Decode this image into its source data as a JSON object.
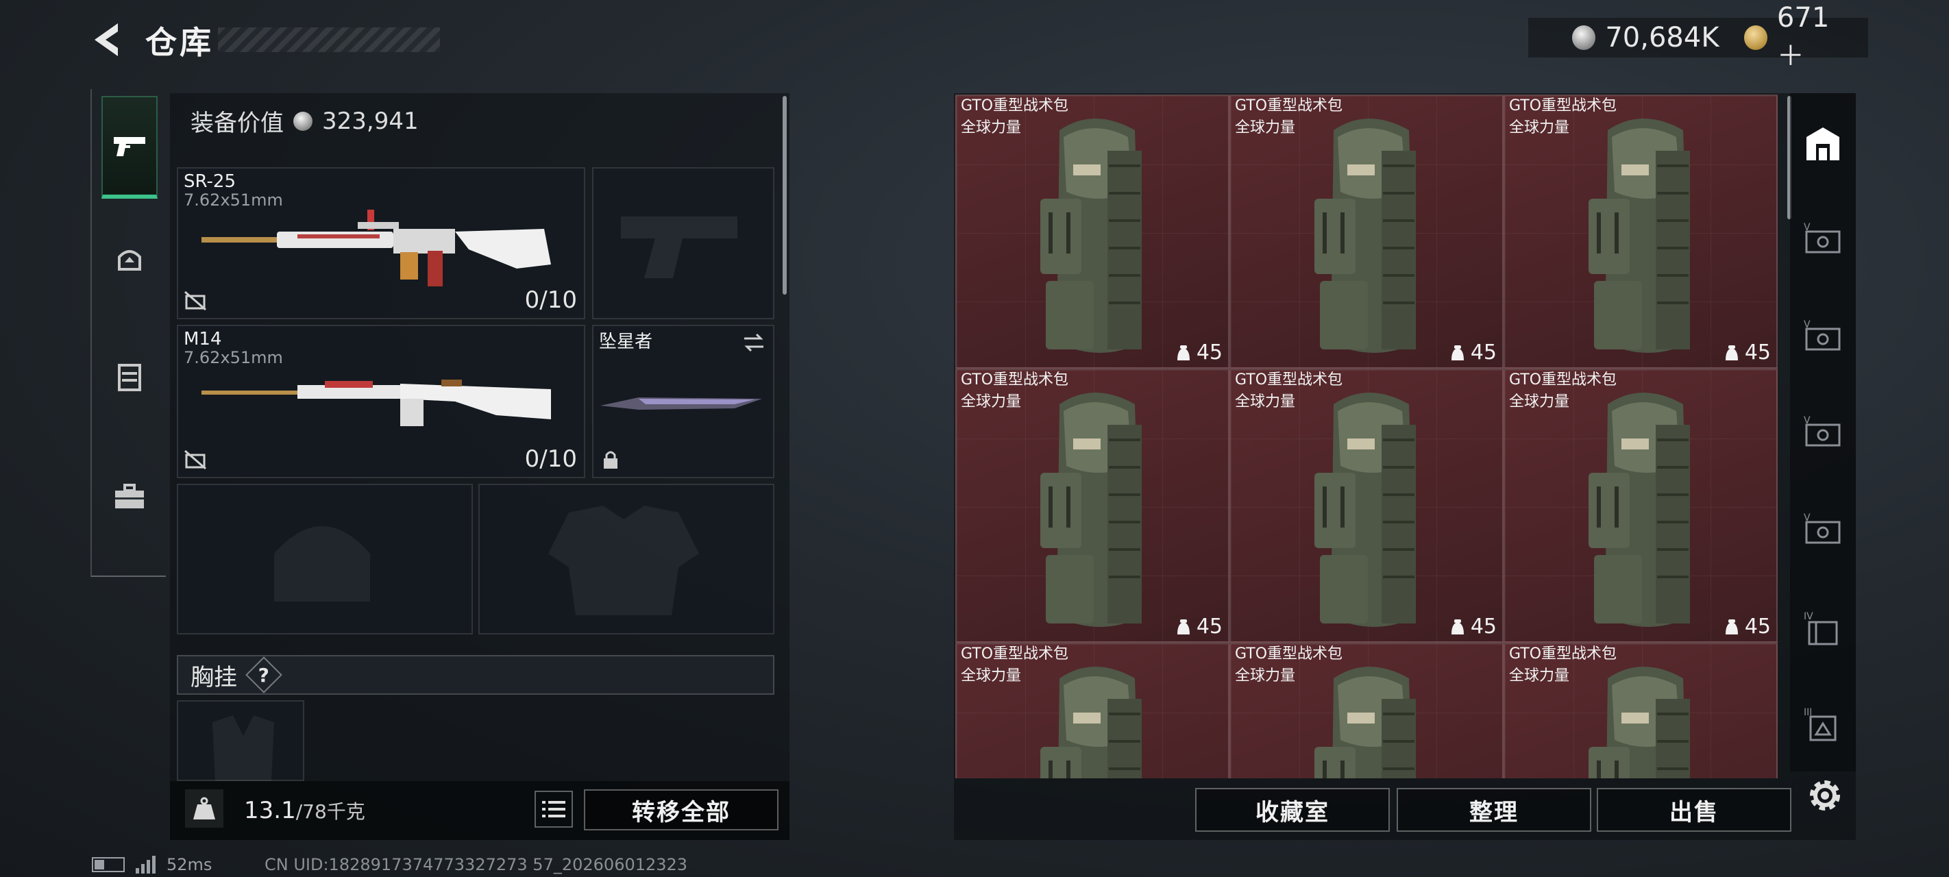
{
  "header": {
    "title": "仓库",
    "currency": [
      {
        "icon": "silver-coin-icon",
        "value": "70,684K"
      },
      {
        "icon": "gold-coin-icon",
        "value": "671＋"
      }
    ]
  },
  "side_tabs": [
    {
      "icon": "pistol-icon",
      "active": true
    },
    {
      "icon": "helmet-icon",
      "active": false
    },
    {
      "icon": "vest-icon",
      "active": false
    },
    {
      "icon": "toolbox-icon",
      "active": false
    }
  ],
  "equipment": {
    "value_label": "装备价值",
    "value": "323,941",
    "primary_weapon": {
      "name": "SR-25",
      "caliber": "7.62x51mm",
      "ammo": "0/10"
    },
    "secondary_weapon": {
      "name": "M14",
      "caliber": "7.62x51mm",
      "ammo": "0/10"
    },
    "melee": {
      "name": "坠星者"
    },
    "chest_rig_label": "胸挂",
    "chest_rig_help": "?"
  },
  "footer_left": {
    "weight_icon_label": "KG",
    "weight_current": "13.1",
    "weight_max": "/78千克",
    "transfer_all": "转移全部"
  },
  "storage": {
    "items": [
      {
        "name": "GTO重型战术包",
        "quality": "全球力量",
        "capacity": "45"
      },
      {
        "name": "GTO重型战术包",
        "quality": "全球力量",
        "capacity": "45"
      },
      {
        "name": "GTO重型战术包",
        "quality": "全球力量",
        "capacity": "45"
      },
      {
        "name": "GTO重型战术包",
        "quality": "全球力量",
        "capacity": "45"
      },
      {
        "name": "GTO重型战术包",
        "quality": "全球力量",
        "capacity": "45"
      },
      {
        "name": "GTO重型战术包",
        "quality": "全球力量",
        "capacity": "45"
      },
      {
        "name": "GTO重型战术包",
        "quality": "全球力量",
        "capacity": ""
      },
      {
        "name": "GTO重型战术包",
        "quality": "全球力量",
        "capacity": ""
      },
      {
        "name": "GTO重型战术包",
        "quality": "全球力量",
        "capacity": ""
      }
    ],
    "buttons": {
      "collection": "收藏室",
      "organize": "整理",
      "sell": "出售"
    },
    "filters": [
      {
        "icon": "all-items-icon",
        "label": ""
      },
      {
        "icon": "storage-v-icon",
        "label": "V"
      },
      {
        "icon": "storage-v-icon",
        "label": "V"
      },
      {
        "icon": "storage-v-icon",
        "label": "V"
      },
      {
        "icon": "storage-v-icon",
        "label": "V"
      },
      {
        "icon": "storage-iv-icon",
        "label": "IV"
      },
      {
        "icon": "storage-iii-icon",
        "label": "III"
      }
    ]
  },
  "status": {
    "ping": "52ms",
    "uid": "CN UID:1828917374773327273 57_202606012323"
  },
  "colors": {
    "accent_green": "#3cc28a",
    "cell_red": "#5a2a2e"
  }
}
